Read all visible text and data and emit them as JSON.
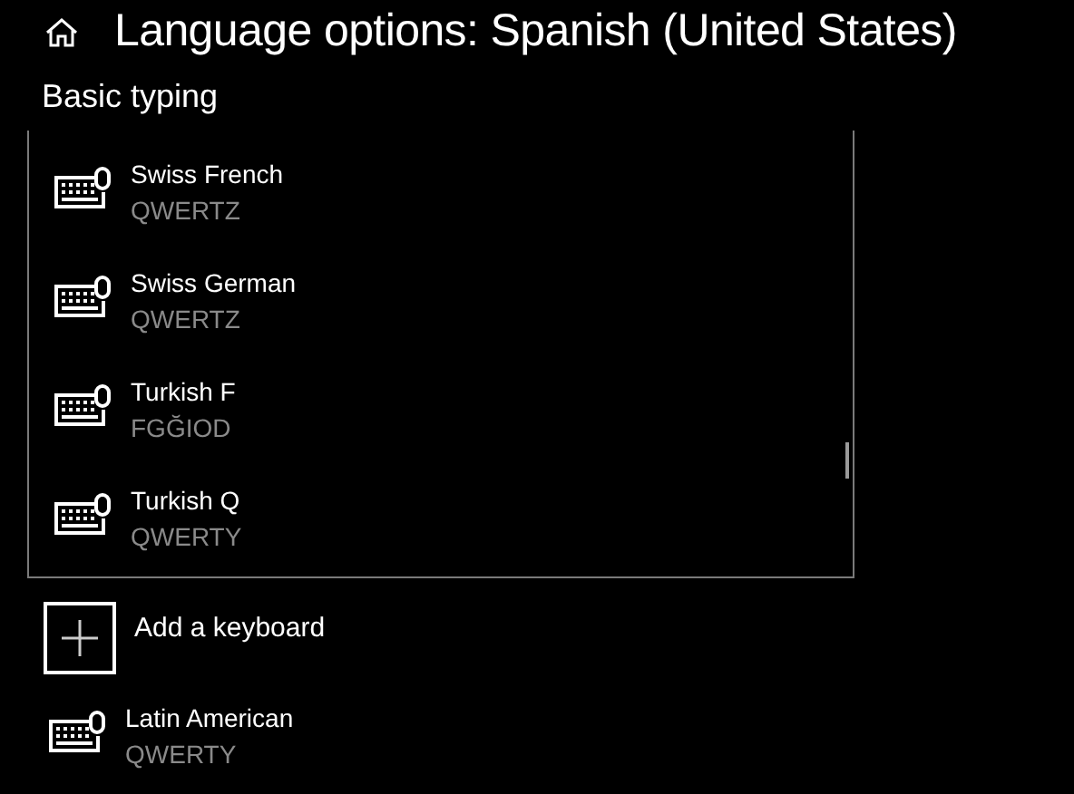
{
  "header": {
    "title": "Language options: Spanish (United States)"
  },
  "section": {
    "title": "Basic typing"
  },
  "dropdown": {
    "items": [
      {
        "name": "Swiss French",
        "layout": "QWERTZ"
      },
      {
        "name": "Swiss German",
        "layout": "QWERTZ"
      },
      {
        "name": "Turkish F",
        "layout": "FGĞIOD"
      },
      {
        "name": "Turkish Q",
        "layout": "QWERTY"
      }
    ]
  },
  "add_keyboard": {
    "label": "Add a keyboard"
  },
  "keyboards": [
    {
      "name": "Latin American",
      "layout": "QWERTY"
    }
  ]
}
